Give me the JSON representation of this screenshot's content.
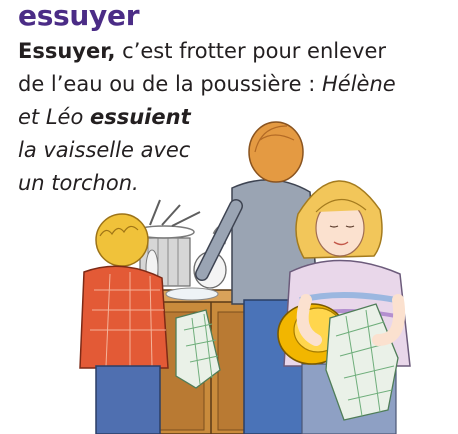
{
  "entry": {
    "headword": "essuyer",
    "definition_term": "Essuyer,",
    "definition_line1_rest": " c’est frotter pour enlever",
    "definition_line2_a": "de l’eau ou de la poussière : ",
    "example_names_1": "Hélène",
    "example_line3_a": "et Léo ",
    "example_verb": "essuient",
    "example_line4": "la vaisselle avec",
    "example_line5": "un torchon."
  },
  "colors": {
    "headword": "#4b2c86",
    "text": "#231f20",
    "girl_hair": "#f2c65a",
    "girl_sweater": "#e9d7ea",
    "mother_shirt": "#9aa4b3",
    "mother_hair": "#e49a42",
    "boy_hair": "#f0c23a",
    "boy_shirt": "#e35a36",
    "bowl": "#f2b600",
    "cabinet": "#c98b3c",
    "cabinet_dark": "#9c6424",
    "towel": "#eaf1e8",
    "towel_check": "#6fae7b",
    "dish_rack": "#b9b9b9"
  }
}
